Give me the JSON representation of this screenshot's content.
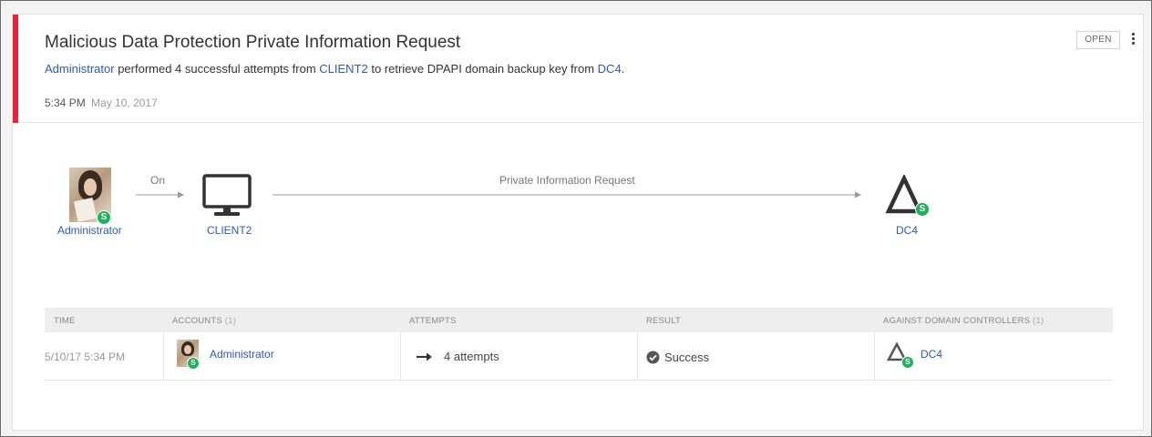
{
  "alert": {
    "title": "Malicious Data Protection Private Information Request",
    "description": {
      "actor": "Administrator",
      "text_1": " performed 4 successful attempts from ",
      "source": "CLIENT2",
      "text_2": " to retrieve DPAPI domain backup key from ",
      "target": "DC4",
      "text_3": "."
    },
    "time": "5:34 PM",
    "date": "May 10, 2017",
    "status_label": "OPEN",
    "severity_color": "#e8223b"
  },
  "flow": {
    "user": {
      "label": "Administrator",
      "badge": "S",
      "icon": "user-photo"
    },
    "edge_1_label": "On",
    "computer": {
      "label": "CLIENT2",
      "icon": "monitor-icon"
    },
    "edge_2_label": "Private Information Request",
    "dc": {
      "label": "DC4",
      "badge": "S",
      "icon": "domain-controller-icon"
    }
  },
  "table": {
    "headers": {
      "time": "TIME",
      "accounts": "ACCOUNTS",
      "accounts_count": "(1)",
      "attempts": "ATTEMPTS",
      "result": "RESULT",
      "dcs": "AGAINST DOMAIN CONTROLLERS",
      "dcs_count": "(1)"
    },
    "rows": [
      {
        "time": "5/10/17 5:34 PM",
        "account": "Administrator",
        "account_badge": "S",
        "attempts": "4 attempts",
        "result": "Success",
        "dc": "DC4",
        "dc_badge": "S"
      }
    ]
  },
  "colors": {
    "link": "#2d59b8",
    "badge": "#1fb05b",
    "accent": "#e8223b"
  }
}
